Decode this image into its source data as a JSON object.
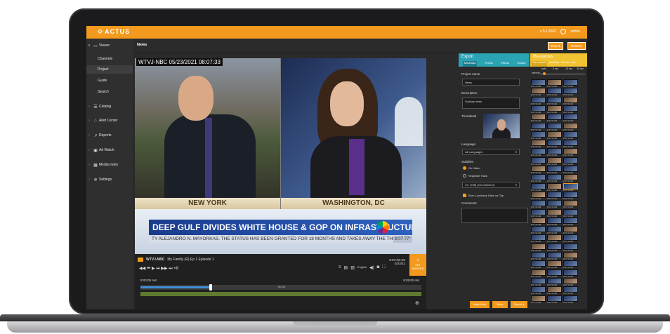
{
  "app": {
    "logo": "ACTUS",
    "version": "v 5.1 6607",
    "user": "admin"
  },
  "sidebar": {
    "items": [
      {
        "label": "Viewer",
        "icon": "monitor-icon",
        "expanded": true
      },
      {
        "label": "Channels",
        "sub": true
      },
      {
        "label": "Project",
        "sub": true,
        "active": true
      },
      {
        "label": "Guide",
        "sub": true
      },
      {
        "label": "Search",
        "sub": true
      },
      {
        "label": "Catalog",
        "icon": "list-icon"
      },
      {
        "label": "Alert Center",
        "icon": "bell-icon"
      },
      {
        "label": "Reports",
        "icon": "chart-icon"
      },
      {
        "label": "Ad Watch",
        "icon": "ad-icon"
      },
      {
        "label": "Media Index",
        "icon": "film-icon"
      },
      {
        "label": "Settings",
        "icon": "gear-icon"
      }
    ]
  },
  "tabs": {
    "active": "News",
    "export_label": "Export",
    "restore_label": "Restore"
  },
  "video": {
    "overlay": "WTVJ-NBC  05/23/2021 08:07:33",
    "loc_left": "NEW YORK",
    "loc_right": "WASHINGTON, DC",
    "headline": "DEEP GULF DIVIDES WHITE HOUSE & GOP ON INFRASTRUCTURE",
    "ticker": "TY ALEJANDRO N. MAYORKAS. THE STATUS HAS BEEN GRANTED FOR 18 MONTHS AND TAKES AWAY THE THREAT",
    "ticker_time": "8:07  77°"
  },
  "player": {
    "channel": "WTVJ-NBC",
    "program": "My Family (R) Ep 1 Episode 1",
    "controls": "◀◀  ⏮  ▶  ⏭  ▶▶  ⏭  ×8",
    "time_top": "8:07:33 AM",
    "date": "5/23/21",
    "lang": "English",
    "set_marker": "SET MARKER",
    "tl_start": "8:00:00 AM",
    "tl_mid": "00:00",
    "tl_end": "8:09:00 AM",
    "progress": 0.25
  },
  "export": {
    "title": "Export",
    "tabs": [
      "Metadata",
      "Points",
      "Effects",
      "Output"
    ],
    "project_name_label": "Project name",
    "project_name_value": "News",
    "description_label": "Description",
    "description_value": "Sunday news",
    "thumbnail_label": "Thumbnail",
    "language_label": "Language",
    "language_value": "All Languages",
    "subtitles_label": "Subtitles",
    "radio_on": "On Video",
    "radio_off": "Separate Track",
    "cc_value": "CC (708) (CC1/teletext)",
    "burn_label": "Burn Loudness Data on Clip",
    "comments_label": "Comments",
    "btn_alert": "Mark Alert",
    "btn_save": "Save",
    "btn_export": "Export"
  },
  "resources": {
    "title": "Resources",
    "tabs": [
      "Thumbnails",
      "Subtitles",
      "Events",
      "Sto"
    ],
    "interval_label": "Interval",
    "interval_ticks": [
      "auto",
      "5 sec",
      "15 sec",
      "30 sec"
    ],
    "thumb_time": "8:07:33 AM",
    "rows": 26
  }
}
